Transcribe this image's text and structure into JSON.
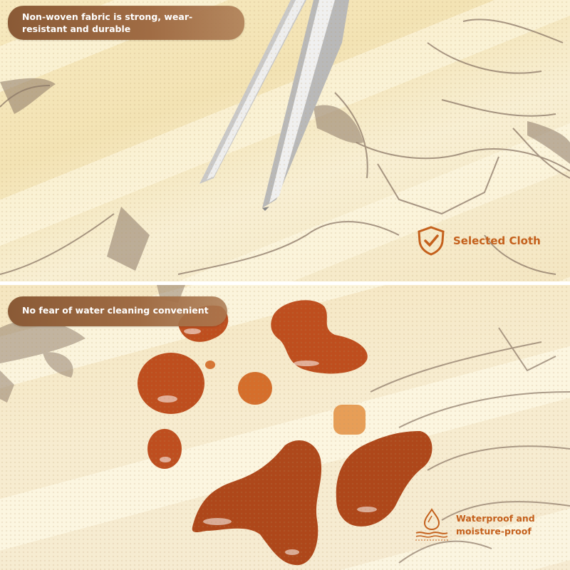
{
  "top_panel": {
    "caption": "Non-woven fabric is strong, wear-resistant and durable",
    "badge": {
      "label": "Selected Cloth",
      "icon": "shield-check-icon"
    }
  },
  "bottom_panel": {
    "caption": "No fear of water cleaning convenient",
    "badge": {
      "line1": "Waterproof and",
      "line2": "moisture-proof",
      "icon": "water-drop-icon"
    }
  },
  "colors": {
    "caption_bg": "#8a5a36",
    "badge_text": "#c4601c",
    "fabric": "#f5ecd0",
    "liquid": "#b8400f"
  }
}
